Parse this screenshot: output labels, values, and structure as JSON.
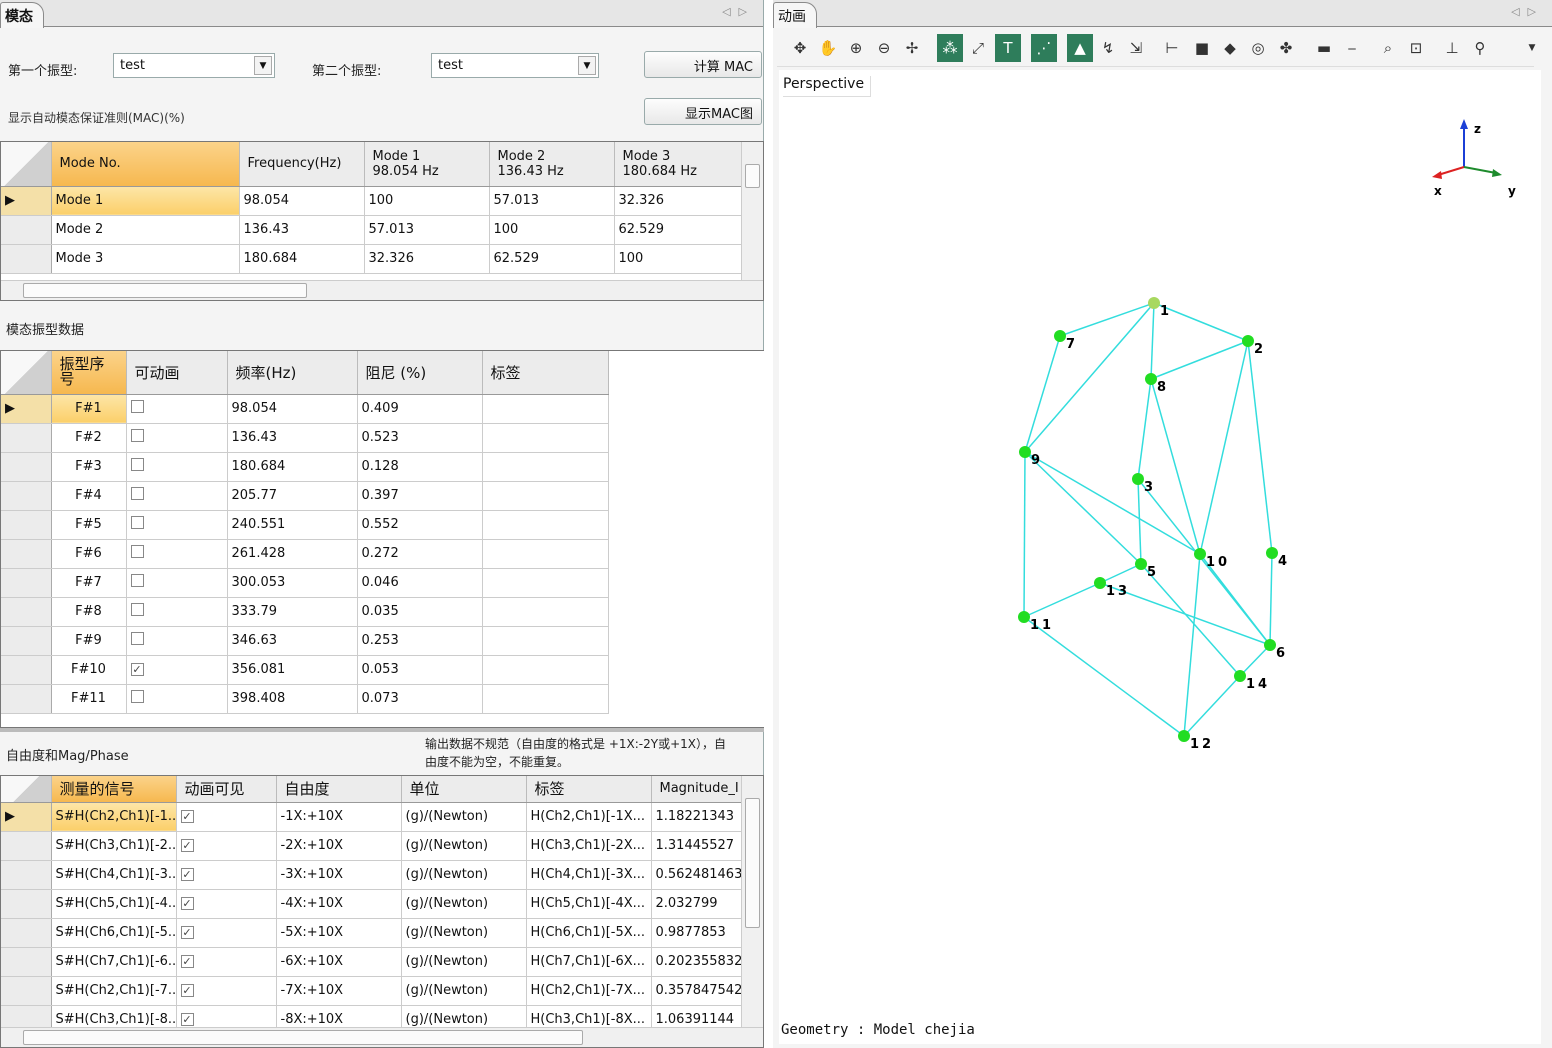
{
  "left_tab": {
    "title": "模态"
  },
  "controls": {
    "first_mode_label": "第一个振型:",
    "first_mode_value": "test",
    "second_mode_label": "第二个振型:",
    "second_mode_value": "test",
    "calc_mac_button": "计算 MAC",
    "show_mac_chart_button": "显示MAC图",
    "mac_section_label": "显示自动模态保证准则(MAC)(%)"
  },
  "mac_table": {
    "headers": [
      "Mode No.",
      "Frequency(Hz)",
      "Mode 1\n98.054 Hz",
      "Mode 2\n136.43 Hz",
      "Mode 3\n180.684 Hz"
    ],
    "rows": [
      [
        "Mode 1",
        "98.054",
        "100",
        "57.013",
        "32.326"
      ],
      [
        "Mode 2",
        "136.43",
        "57.013",
        "100",
        "62.529"
      ],
      [
        "Mode 3",
        "180.684",
        "32.326",
        "62.529",
        "100"
      ]
    ]
  },
  "mode_section_label": "模态振型数据",
  "mode_table": {
    "headers": [
      "振型序号",
      "可动画",
      "频率(Hz)",
      "阻尼 (%)",
      "标签"
    ],
    "rows": [
      {
        "id": "F#1",
        "anim": false,
        "freq": "98.054",
        "damp": "0.409",
        "tag": ""
      },
      {
        "id": "F#2",
        "anim": false,
        "freq": "136.43",
        "damp": "0.523",
        "tag": ""
      },
      {
        "id": "F#3",
        "anim": false,
        "freq": "180.684",
        "damp": "0.128",
        "tag": ""
      },
      {
        "id": "F#4",
        "anim": false,
        "freq": "205.77",
        "damp": "0.397",
        "tag": ""
      },
      {
        "id": "F#5",
        "anim": false,
        "freq": "240.551",
        "damp": "0.552",
        "tag": ""
      },
      {
        "id": "F#6",
        "anim": false,
        "freq": "261.428",
        "damp": "0.272",
        "tag": ""
      },
      {
        "id": "F#7",
        "anim": false,
        "freq": "300.053",
        "damp": "0.046",
        "tag": ""
      },
      {
        "id": "F#8",
        "anim": false,
        "freq": "333.79",
        "damp": "0.035",
        "tag": ""
      },
      {
        "id": "F#9",
        "anim": false,
        "freq": "346.63",
        "damp": "0.253",
        "tag": ""
      },
      {
        "id": "F#10",
        "anim": true,
        "freq": "356.081",
        "damp": "0.053",
        "tag": ""
      },
      {
        "id": "F#11",
        "anim": false,
        "freq": "398.408",
        "damp": "0.073",
        "tag": ""
      }
    ]
  },
  "dof_section_label": "自由度和Mag/Phase",
  "dof_warning": "输出数据不规范（自由度的格式是 +1X:-2Y或+1X），自由度不能为空，不能重复。",
  "dof_table": {
    "headers": [
      "测量的信号",
      "动画可见",
      "自由度",
      "单位",
      "标签",
      "Magnitude_I"
    ],
    "rows": [
      [
        "S#H(Ch2,Ch1)[-1...",
        true,
        "-1X:+10X",
        "(g)/(Newton)",
        "H(Ch2,Ch1)[-1X...",
        "1.18221343"
      ],
      [
        "S#H(Ch3,Ch1)[-2...",
        true,
        "-2X:+10X",
        "(g)/(Newton)",
        "H(Ch3,Ch1)[-2X...",
        "1.31445527"
      ],
      [
        "S#H(Ch4,Ch1)[-3...",
        true,
        "-3X:+10X",
        "(g)/(Newton)",
        "H(Ch4,Ch1)[-3X...",
        "0.562481463"
      ],
      [
        "S#H(Ch5,Ch1)[-4...",
        true,
        "-4X:+10X",
        "(g)/(Newton)",
        "H(Ch5,Ch1)[-4X...",
        "2.032799"
      ],
      [
        "S#H(Ch6,Ch1)[-5...",
        true,
        "-5X:+10X",
        "(g)/(Newton)",
        "H(Ch6,Ch1)[-5X...",
        "0.9877853"
      ],
      [
        "S#H(Ch7,Ch1)[-6...",
        true,
        "-6X:+10X",
        "(g)/(Newton)",
        "H(Ch7,Ch1)[-6X...",
        "0.202355832"
      ],
      [
        "S#H(Ch2,Ch1)[-7...",
        true,
        "-7X:+10X",
        "(g)/(Newton)",
        "H(Ch2,Ch1)[-7X...",
        "0.357847542"
      ],
      [
        "S#H(Ch3,Ch1)[-8...",
        true,
        "-8X:+10X",
        "(g)/(Newton)",
        "H(Ch3,Ch1)[-8X...",
        "1.06391144"
      ]
    ]
  },
  "right_tab": {
    "title": "动画"
  },
  "viewport": {
    "perspective_label": "Perspective",
    "geometry_label": "Geometry : Model chejia",
    "axes": {
      "x": "x",
      "y": "y",
      "z": "z"
    },
    "node_color": "#22dd22",
    "selected_node_color": "#a8d860",
    "edge_color": "#33dddd",
    "nodes": [
      {
        "id": "1"
      },
      {
        "id": "2"
      },
      {
        "id": "3"
      },
      {
        "id": "4"
      },
      {
        "id": "5"
      },
      {
        "id": "6"
      },
      {
        "id": "7"
      },
      {
        "id": "8"
      },
      {
        "id": "9"
      },
      {
        "id": "10"
      },
      {
        "id": "11"
      },
      {
        "id": "12"
      },
      {
        "id": "13"
      },
      {
        "id": "14"
      }
    ],
    "edges": [
      [
        "1",
        "7"
      ],
      [
        "1",
        "2"
      ],
      [
        "1",
        "8"
      ],
      [
        "1",
        "9"
      ],
      [
        "7",
        "9"
      ],
      [
        "2",
        "8"
      ],
      [
        "2",
        "4"
      ],
      [
        "2",
        "10"
      ],
      [
        "8",
        "3"
      ],
      [
        "8",
        "10"
      ],
      [
        "9",
        "11"
      ],
      [
        "9",
        "5"
      ],
      [
        "9",
        "10"
      ],
      [
        "3",
        "5"
      ],
      [
        "3",
        "6"
      ],
      [
        "4",
        "6"
      ],
      [
        "5",
        "13"
      ],
      [
        "5",
        "14"
      ],
      [
        "10",
        "6"
      ],
      [
        "10",
        "12"
      ],
      [
        "13",
        "11"
      ],
      [
        "13",
        "6"
      ],
      [
        "11",
        "12"
      ],
      [
        "14",
        "12"
      ],
      [
        "6",
        "14"
      ]
    ]
  }
}
